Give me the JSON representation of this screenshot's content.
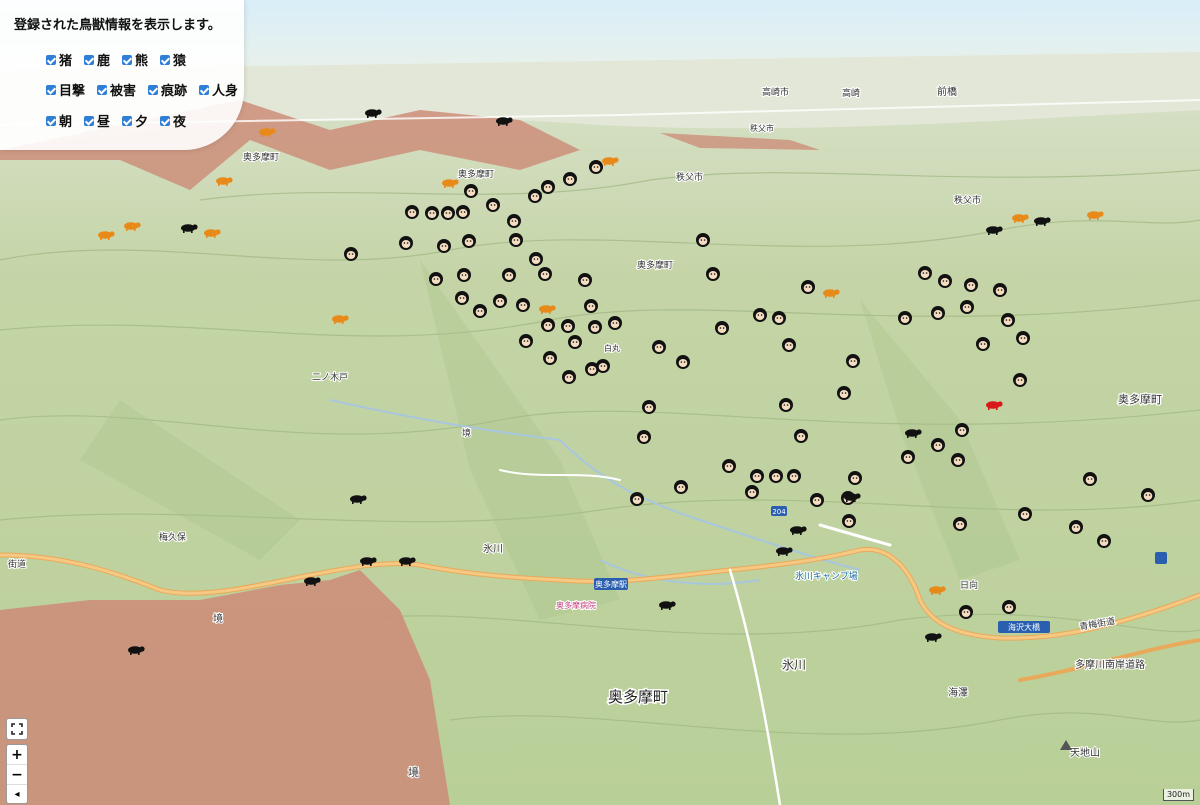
{
  "panel": {
    "title": "登録された鳥獣情報を表示します。",
    "animals": [
      {
        "label": "猪",
        "checked": true
      },
      {
        "label": "鹿",
        "checked": true
      },
      {
        "label": "熊",
        "checked": true
      },
      {
        "label": "猿",
        "checked": true
      }
    ],
    "types": [
      {
        "label": "目撃",
        "checked": true
      },
      {
        "label": "被害",
        "checked": true
      },
      {
        "label": "痕跡",
        "checked": true
      },
      {
        "label": "人身",
        "checked": true
      }
    ],
    "times": [
      {
        "label": "朝",
        "checked": true
      },
      {
        "label": "昼",
        "checked": true
      },
      {
        "label": "夕",
        "checked": true
      },
      {
        "label": "夜",
        "checked": true
      }
    ]
  },
  "controls": {
    "fullscreen_icon": "expand-icon",
    "zoom_in": "+",
    "zoom_out": "−",
    "compass": "◂"
  },
  "scale": "300m",
  "colors": {
    "sky": "#d6ebf7",
    "terrain": "#c2d3a2",
    "terrain_dark": "#a9bf86",
    "zone": "#cc8e7a",
    "road": "#f0b868",
    "river": "#9ec0dc",
    "sighting": "#111111",
    "damage": "#e88a1a",
    "injury": "#d91a1a"
  },
  "place_labels": {
    "okutama_main": "奥多摩町",
    "okutama_east": "奥多摩町",
    "okutama_top": "奥多摩町",
    "okutama_mid": "奥多摩町",
    "okutama_nw": "奥多摩町",
    "hikawa_low": "氷川",
    "hikawa_mid": "氷川",
    "chichibu_a": "秩父市",
    "chichibu_b": "秩父市",
    "chichibu_c": "秩父市",
    "takasaki": "高崎市",
    "takasaki2": "高崎",
    "maebashi": "前橋",
    "kaisawa": "海澤",
    "tenchiyama": "天地山",
    "kaizawa_bridge": "海沢大橋",
    "ome_kaido": "青梅街道",
    "tamagawa_road": "多摩川南岸道路",
    "hikawa_camp": "氷川キャンプ場",
    "okutama_station": "奥多摩駅",
    "okutama_hospital": "奥多摩病院",
    "sakai_a": "境",
    "sakai_b": "境",
    "sakai_c": "境",
    "ume": "梅久保",
    "nijiri": "二ノ木戸",
    "shiromaru": "白丸",
    "route_204": "204",
    "hikage": "日向",
    "shiokaidou": "街道"
  }
}
